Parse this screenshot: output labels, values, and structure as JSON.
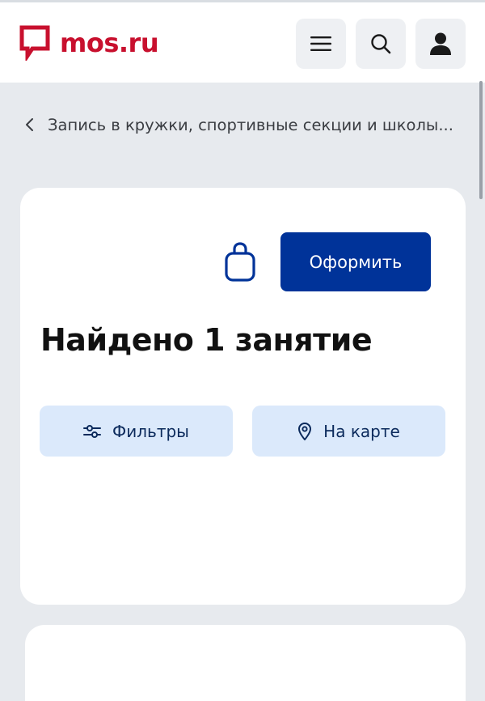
{
  "header": {
    "logo_text": "mos.ru",
    "brand_color": "#c8102e",
    "menu_icon": "hamburger-menu-icon",
    "search_icon": "search-icon",
    "profile_icon": "user-profile-icon"
  },
  "breadcrumb": {
    "back_icon": "chevron-left-icon",
    "label": "Запись в кружки, спортивные секции и школы..."
  },
  "card": {
    "cart_icon": "shopping-bag-icon",
    "order_button_label": "Оформить",
    "order_button_color": "#003399",
    "title": "Найдено 1 занятие",
    "filters_button_label": "Фильтры",
    "filters_icon": "sliders-icon",
    "map_button_label": "На карте",
    "map_icon": "map-pin-icon",
    "pill_color": "#dbe9fb"
  }
}
